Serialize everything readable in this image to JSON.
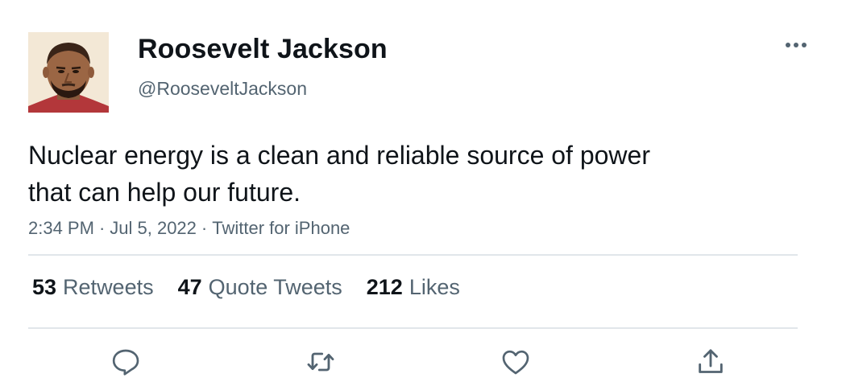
{
  "tweet": {
    "author": {
      "display_name": "Roosevelt Jackson",
      "handle": "@RooseveltJackson"
    },
    "text": "Nuclear energy is a clean and reliable source of power\nthat can help our future.",
    "meta": {
      "time": "2:34 PM",
      "date": "Jul 5, 2022",
      "source": "Twitter for iPhone",
      "separator": "·"
    },
    "stats": [
      {
        "count": "53",
        "label": "Retweets"
      },
      {
        "count": "47",
        "label": "Quote Tweets"
      },
      {
        "count": "212",
        "label": "Likes"
      }
    ],
    "actions": [
      "reply-icon",
      "retweet-icon",
      "like-icon",
      "share-icon"
    ]
  },
  "colors": {
    "primary_text": "#0f1419",
    "secondary_text": "#536471",
    "divider": "#e1e6ea"
  }
}
